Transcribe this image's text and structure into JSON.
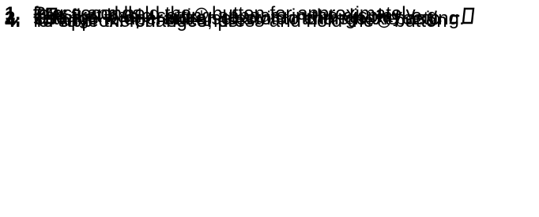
{
  "steps": [
    {
      "marker": "1.",
      "lines": [
        {
          "before": "Press and hold the",
          "icon": "clock-icon",
          "after": "button for approximately"
        },
        {
          "text": "four seconds."
        }
      ]
    },
    {
      "marker_icon": "checkmark-arrow-icon",
      "lines": [
        {
          "before": "The first basic setting appears in the display, e.g.",
          "display_code_1": "c0"
        },
        {
          "display_code_2": "12",
          "after": "."
        }
      ]
    },
    {
      "marker": "2.",
      "lines": [
        {
          "text": "Use the temperature selector to change the setting."
        }
      ]
    },
    {
      "marker": "3.",
      "lines": [
        {
          "before": "Use the",
          "minus_icon": "minus-icon",
          "middle": "or",
          "plus_icon": "plus-icon",
          "after": "button to switch to the next basic"
        },
        {
          "text": "setting."
        }
      ]
    },
    {
      "marker": "4.",
      "lines": [
        {
          "before": "To save the changes, press and hold the",
          "icon": "clock-icon",
          "after": "button"
        },
        {
          "text": "for approx. four seconds."
        }
      ]
    }
  ]
}
